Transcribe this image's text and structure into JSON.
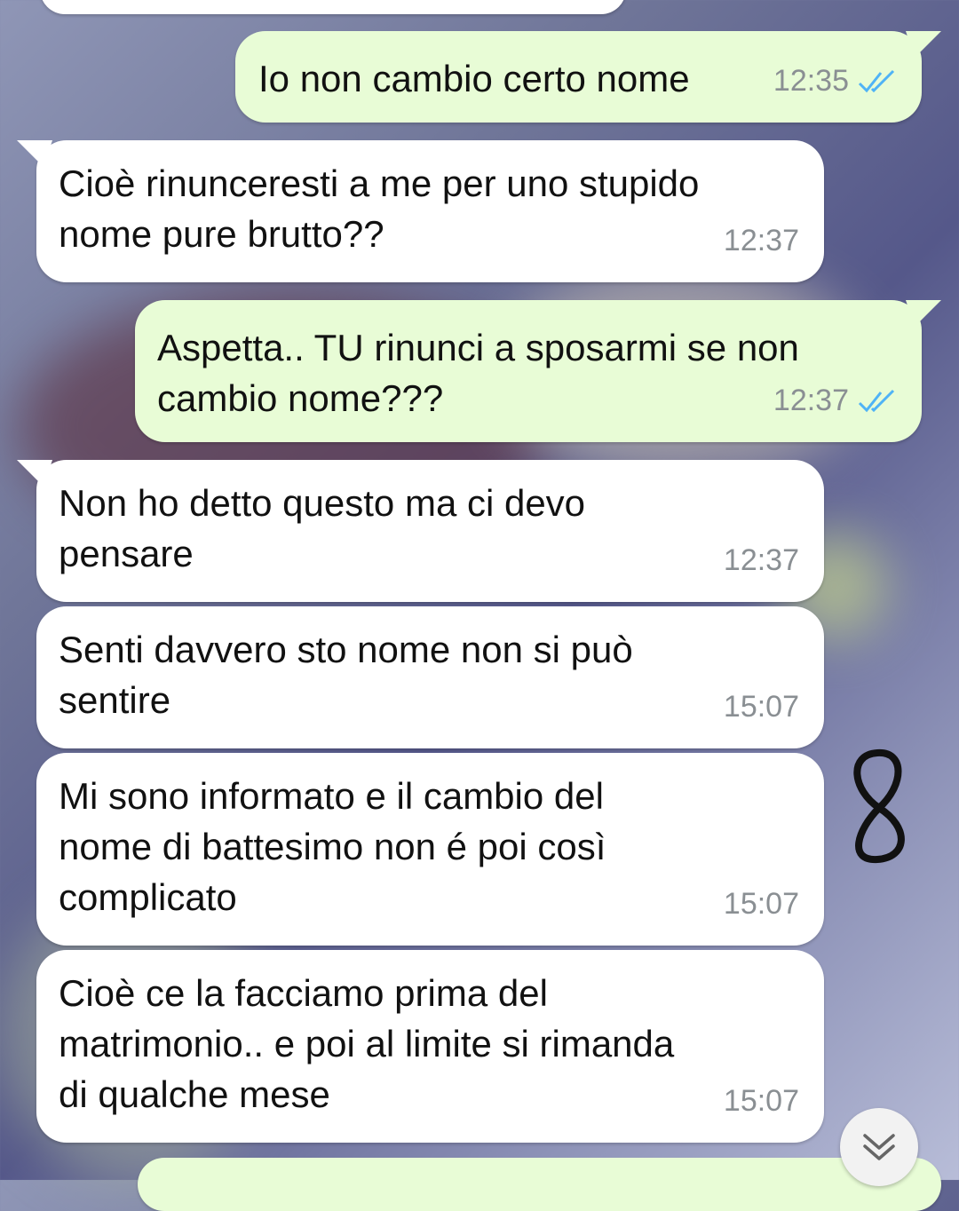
{
  "messages": [
    {
      "text": "Io non cambio certo nome",
      "time": "12:35"
    },
    {
      "text": "Cioè rinunceresti a me per uno stupido\nnome pure brutto??",
      "time": "12:37"
    },
    {
      "text": "Aspetta.. TU rinunci a sposarmi se non\ncambio nome???",
      "time": "12:37"
    },
    {
      "text": "Non ho detto questo ma ci devo\npensare",
      "time": "12:37"
    },
    {
      "text": "Senti davvero sto nome non si può\nsentire",
      "time": "15:07"
    },
    {
      "text": "Mi sono informato e il cambio del\nnome di battesimo non é poi così\ncomplicato",
      "time": "15:07"
    },
    {
      "text": "Cioè ce la facciamo prima del\nmatrimonio.. e poi al limite si rimanda\ndi qualche mese",
      "time": "15:07"
    }
  ],
  "icons": {
    "read_receipt": "double-check-icon",
    "scroll_down": "chevron-double-down-icon",
    "annotation": "handwritten-eight-icon"
  },
  "colors": {
    "incoming_bubble": "#ffffff",
    "outgoing_bubble": "#e8fcd6",
    "read_ticks": "#4fb3f6",
    "timestamp": "#8a8f93"
  }
}
